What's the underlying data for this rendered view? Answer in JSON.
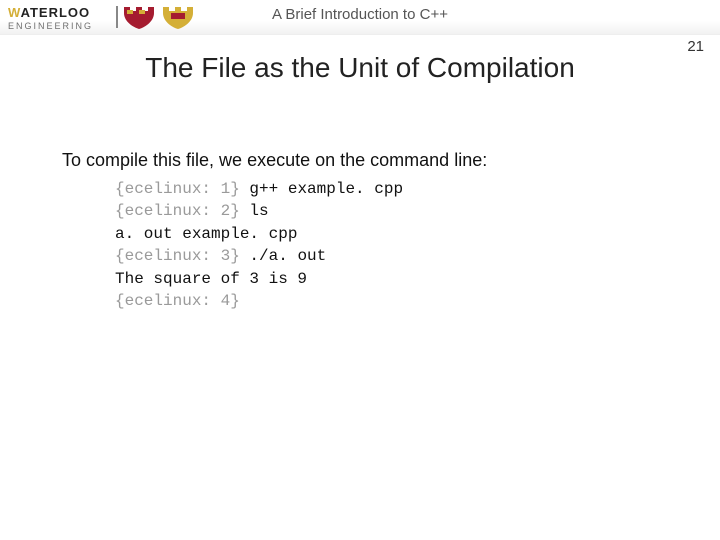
{
  "header": {
    "logo": {
      "word": "WATERLOO",
      "subtitle": "ENGINEERING",
      "gold": "#d4af37",
      "dark": "#222222",
      "subtitle_color": "#6f6f6f"
    },
    "doc_title": "A Brief Introduction to C++"
  },
  "page_number": "21",
  "slide_title": "The File as the Unit of Compilation",
  "body": {
    "intro": "To compile this file, we execute on the command line:"
  },
  "terminal": [
    {
      "prompt": "{ecelinux: 1}",
      "cmd": " g++ example. cpp"
    },
    {
      "prompt": "{ecelinux: 2}",
      "cmd": " ls"
    },
    {
      "prompt": "",
      "cmd": "a. out       example. cpp"
    },
    {
      "prompt": "{ecelinux: 3}",
      "cmd": " ./a. out"
    },
    {
      "prompt": "",
      "cmd": "The square of 3 is 9"
    },
    {
      "prompt": "{ecelinux: 4}",
      "cmd": ""
    }
  ]
}
